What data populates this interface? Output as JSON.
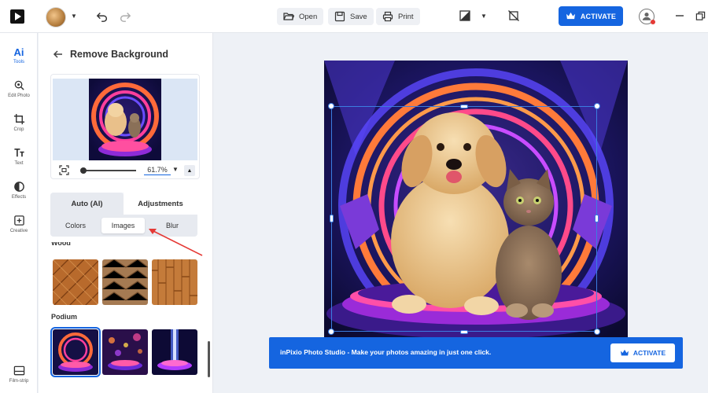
{
  "toolbar": {
    "open_label": "Open",
    "save_label": "Save",
    "print_label": "Print",
    "activate_label": "ACTIVATE"
  },
  "rail": {
    "items": [
      {
        "label": "Tools",
        "icon": "ai-icon"
      },
      {
        "label": "Edit Photo",
        "icon": "edit-photo-icon"
      },
      {
        "label": "Crop",
        "icon": "crop-icon"
      },
      {
        "label": "Text",
        "icon": "text-icon"
      },
      {
        "label": "Effects",
        "icon": "effects-icon"
      },
      {
        "label": "Creative",
        "icon": "creative-icon"
      }
    ],
    "bottom_label": "Film-strip",
    "ai_glyph": "Ai"
  },
  "panel": {
    "title": "Remove Background",
    "zoom_value": "61.7%",
    "tabs": [
      "Auto (AI)",
      "Adjustments"
    ],
    "subtabs": [
      "Colors",
      "Images",
      "Blur"
    ],
    "categories": [
      "Wood",
      "Podium"
    ]
  },
  "banner": {
    "text": "inPixio Photo Studio - Make your photos amazing in just one click.",
    "activate_label": "ACTIVATE"
  },
  "colors": {
    "accent": "#1565e0",
    "arrow": "#e53935"
  }
}
